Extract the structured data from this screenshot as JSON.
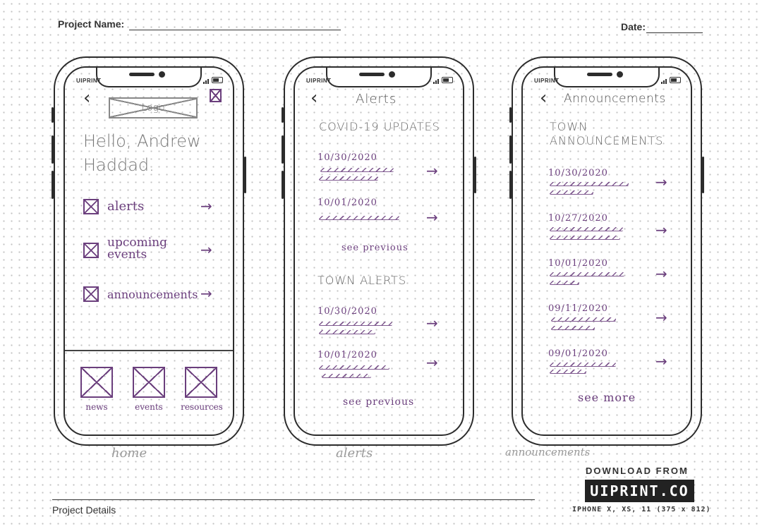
{
  "sheet": {
    "project_name_label": "Project Name:",
    "date_label": "Date:",
    "project_details_label": "Project Details",
    "download_from": "DOWNLOAD FROM",
    "brand_box": "UIPRINT.CO",
    "device_spec": "IPHONE X, XS, 11 (375 x 812)"
  },
  "phone_brand": "UIPRINT",
  "colors": {
    "ink": "#6b3f7d",
    "pencil": "#555555",
    "outline": "#2c2c2c"
  },
  "screens": {
    "home": {
      "back_icon": "‹",
      "logo_text": "Logo",
      "greeting_line1": "Hello, Andrew",
      "greeting_line2": "Haddad.",
      "menu": [
        {
          "label": "alerts",
          "arrow": "→"
        },
        {
          "label_line1": "upcoming",
          "label_line2": "events",
          "arrow": "→"
        },
        {
          "label": "announcements",
          "arrow": "→"
        }
      ],
      "tabs": [
        "news",
        "events",
        "resources"
      ],
      "caption": "home"
    },
    "alerts": {
      "back_icon": "‹",
      "title": "Alerts",
      "section1": "COVID-19 UPDATES",
      "section1_items": [
        "10/30/2020",
        "10/01/2020"
      ],
      "section1_link": "see previous",
      "section2": "TOWN ALERTS",
      "section2_items": [
        "10/30/2020",
        "10/01/2020"
      ],
      "section2_link": "see previous",
      "caption": "alerts"
    },
    "announcements": {
      "back_icon": "‹",
      "title": "Announcements",
      "section_line1": "TOWN",
      "section_line2": "ANNOUNCEMENTS",
      "items": [
        "10/30/2020",
        "10/27/2020",
        "10/01/2020",
        "09/11/2020",
        "09/01/2020"
      ],
      "link": "see more",
      "caption": "announcements"
    }
  }
}
